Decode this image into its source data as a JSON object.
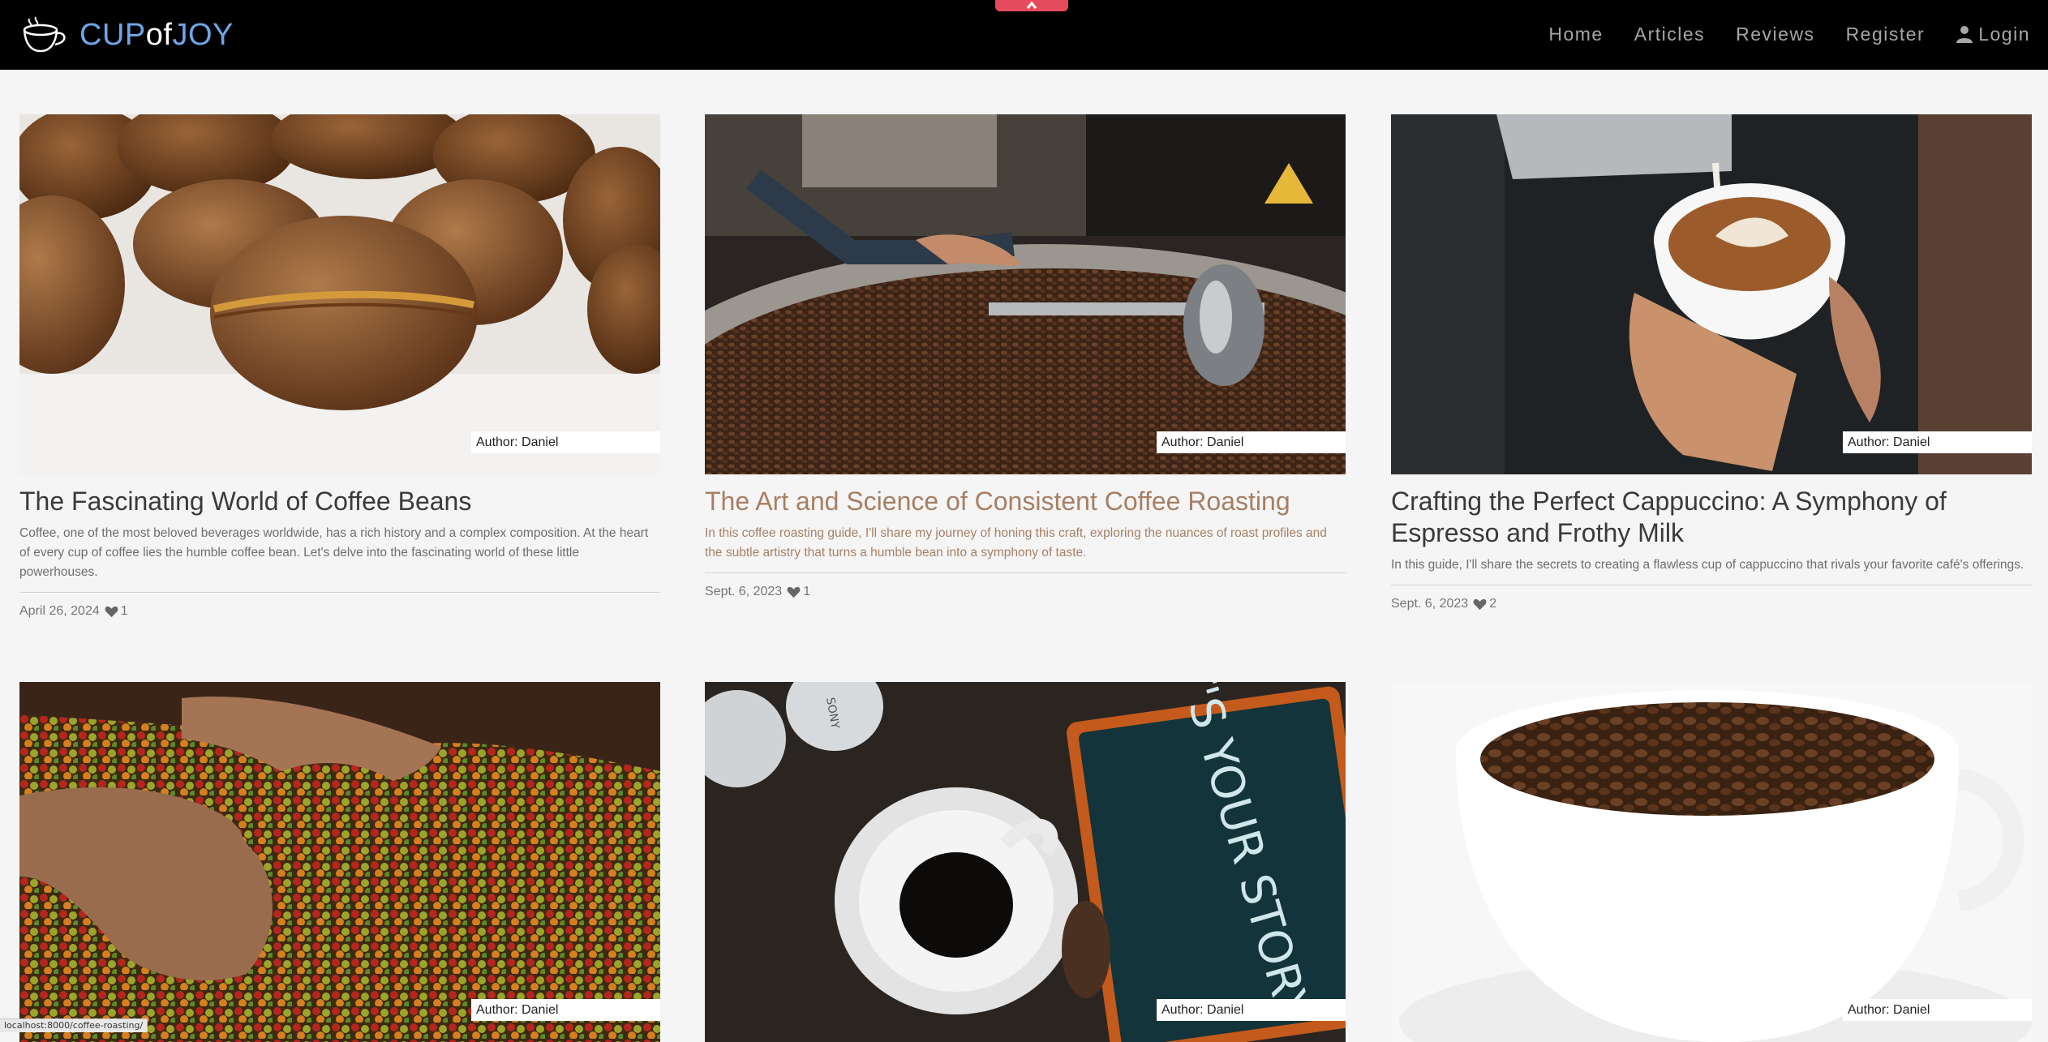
{
  "brand": {
    "part1": "CUP",
    "part2": "of",
    "part3": "JOY"
  },
  "nav": {
    "home": "Home",
    "articles": "Articles",
    "reviews": "Reviews",
    "register": "Register",
    "login": "Login"
  },
  "cards": [
    {
      "author": "Author: Daniel",
      "title": "The Fascinating World of Coffee Beans",
      "desc": "Coffee, one of the most beloved beverages worldwide, has a rich history and a complex composition. At the heart of every cup of coffee lies the humble coffee bean. Let's delve into the fascinating world of these little powerhouses.",
      "date": "April 26, 2024",
      "likes": "1"
    },
    {
      "author": "Author: Daniel",
      "title": "The Art and Science of Consistent Coffee Roasting",
      "desc": "In this coffee roasting guide, I'll share my journey of honing this craft, exploring the nuances of roast profiles and the subtle artistry that turns a humble bean into a symphony of taste.",
      "date": "Sept. 6, 2023",
      "likes": "1"
    },
    {
      "author": "Author: Daniel",
      "title": "Crafting the Perfect Cappuccino: A Symphony of Espresso and Frothy Milk",
      "desc": "In this guide, I'll share the secrets to creating a flawless cup of cappuccino that rivals your favorite café's offerings.",
      "date": "Sept. 6, 2023",
      "likes": "2"
    },
    {
      "author": "Author: Daniel"
    },
    {
      "author": "Author: Daniel",
      "image_text": "WHAT'S YOUR STORY",
      "headphone_brand": "SONY"
    },
    {
      "author": "Author: Daniel"
    }
  ],
  "status_url": "localhost:8000/coffee-roasting/"
}
